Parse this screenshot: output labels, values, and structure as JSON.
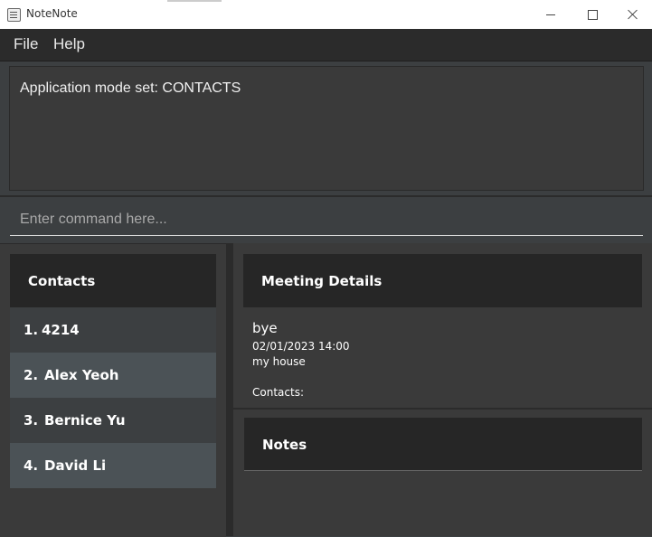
{
  "window": {
    "title": "NoteNote"
  },
  "menu": {
    "file": "File",
    "help": "Help"
  },
  "result": {
    "text": "Application mode set: CONTACTS"
  },
  "command": {
    "placeholder": "Enter command here..."
  },
  "contacts": {
    "header": "Contacts",
    "items": [
      {
        "index": "1.",
        "name": "4214"
      },
      {
        "index": "2.",
        "name": "Alex Yeoh"
      },
      {
        "index": "3.",
        "name": "Bernice Yu"
      },
      {
        "index": "4.",
        "name": "David Li"
      }
    ]
  },
  "meeting": {
    "header": "Meeting Details",
    "title": "bye",
    "datetime": "02/01/2023 14:00",
    "location": "my house",
    "contacts_label": "Contacts:"
  },
  "notes": {
    "header": "Notes"
  },
  "colors": {
    "background": "#3c3f41",
    "header": "#262626",
    "row_alt": "#4b5256"
  },
  "icons": {
    "app": "app-icon",
    "minimize": "minimize-icon",
    "maximize": "maximize-icon",
    "close": "close-icon"
  }
}
